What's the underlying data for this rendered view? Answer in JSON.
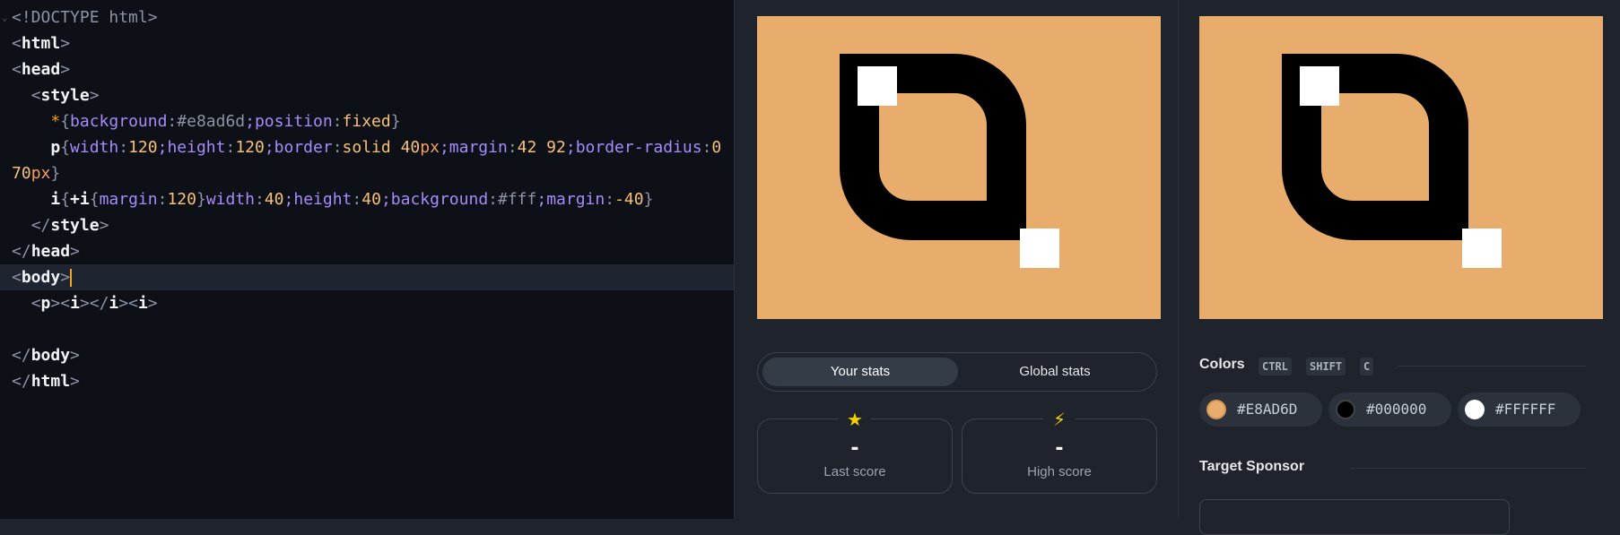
{
  "editor": {
    "lines": {
      "l1_doctype": "<!DOCTYPE html>",
      "l2_html": "html",
      "l3_head": "head",
      "l4_style": "style",
      "l5_sel": "*",
      "l5_p1": "background",
      "l5_v1": "#e8ad6d",
      "l5_p2": "position",
      "l5_v2": "fixed",
      "l6_sel": "p",
      "l6_p1": "width",
      "l6_v1": "120",
      "l6_p2": "height",
      "l6_v2": "120",
      "l6_p3": "border",
      "l6_v3": "solid 40",
      "l6_u3": "px",
      "l6_p4": "margin",
      "l6_v4": "42 92",
      "l6_p5": "border-radius",
      "l6_v5": "0",
      "l7_v": "70",
      "l7_u": "px",
      "l8_sel_a": "i",
      "l8_sel_b": "+i",
      "l8_p1": "margin",
      "l8_v1": "120",
      "l8_p2": "width",
      "l8_v2": "40",
      "l8_p3": "height",
      "l8_v3": "40",
      "l8_p4": "background",
      "l8_v4": "#fff",
      "l8_p5": "margin",
      "l8_v5": "-40",
      "l9_style": "style",
      "l10_head": "head",
      "l11_body": "body",
      "l12_p": "p",
      "l12_i": "i",
      "l12_i2": "i",
      "l12_i3": "i",
      "l14_body": "body",
      "l15_html": "html"
    }
  },
  "stats": {
    "tab_yours": "Your stats",
    "tab_global": "Global stats",
    "last_score_value": "-",
    "last_score_label": "Last score",
    "high_score_value": "-",
    "high_score_label": "High score",
    "star_icon": "star-icon",
    "bolt_icon": "lightning-icon"
  },
  "colors": {
    "title": "Colors",
    "shortcut": [
      "CTRL",
      "SHIFT",
      "C"
    ],
    "swatches": [
      {
        "hex": "#E8AD6D",
        "color": "#e8ad6d"
      },
      {
        "hex": "#000000",
        "color": "#000000"
      },
      {
        "hex": "#FFFFFF",
        "color": "#ffffff"
      }
    ]
  },
  "target_sponsor": {
    "title": "Target Sponsor"
  }
}
